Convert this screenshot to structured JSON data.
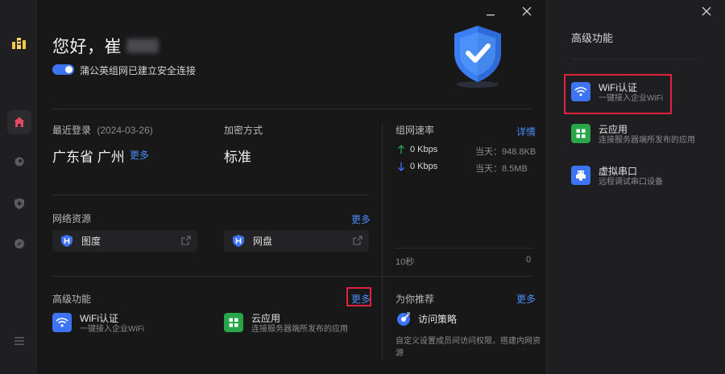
{
  "header": {
    "greeting": "您好，崔",
    "connection_text": "蒲公英组网已建立安全连接"
  },
  "info": {
    "last_login_label": "最近登录",
    "last_login_date": "(2024-03-26)",
    "location": "广东省 广州",
    "location_more": "更多",
    "encrypt_label": "加密方式",
    "encrypt_value": "标准"
  },
  "speed": {
    "title": "组网速率",
    "detail_link": "详情",
    "upload": "0 Kbps",
    "download": "0 Kbps",
    "upload_today": "当天：948.8KB",
    "download_today": "当天：8.5MB",
    "time_label": "10秒",
    "axis_zero": "0"
  },
  "network_resources": {
    "title": "网络资源",
    "more": "更多",
    "items": [
      {
        "label": "图度"
      },
      {
        "label": "网盘"
      }
    ]
  },
  "advanced": {
    "title": "高级功能",
    "more": "更多",
    "items": [
      {
        "title": "WiFi认证",
        "subtitle": "一键接入企业WiFi"
      },
      {
        "title": "云应用",
        "subtitle": "连接服务器端所发布的应用"
      }
    ]
  },
  "recommend": {
    "title": "为你推荐",
    "more": "更多",
    "item_title": "访问策略",
    "item_desc": "自定义设置成员间访问权限，搭建内网资源"
  },
  "right_panel": {
    "title": "高级功能",
    "items": [
      {
        "title": "WiFi认证",
        "subtitle": "一键接入企业WiFi"
      },
      {
        "title": "云应用",
        "subtitle": "连接服务器端所发布的应用"
      },
      {
        "title": "虚拟串口",
        "subtitle": "远程调试串口设备"
      }
    ]
  },
  "colors": {
    "accent": "#3d74f5",
    "link": "#4a8cf7",
    "green": "#2aa64a",
    "highlight": "#e0223f"
  }
}
